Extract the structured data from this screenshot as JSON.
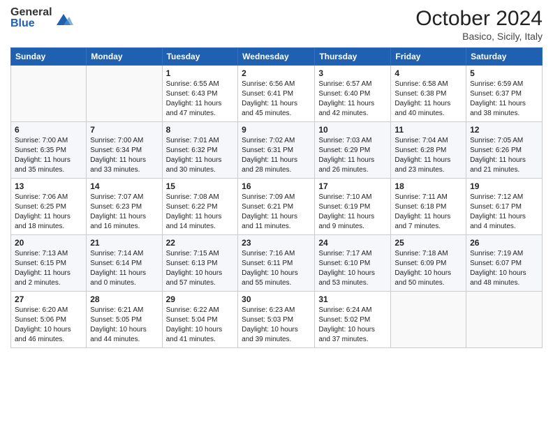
{
  "logo": {
    "general": "General",
    "blue": "Blue"
  },
  "header": {
    "month": "October 2024",
    "location": "Basico, Sicily, Italy"
  },
  "weekdays": [
    "Sunday",
    "Monday",
    "Tuesday",
    "Wednesday",
    "Thursday",
    "Friday",
    "Saturday"
  ],
  "weeks": [
    [
      {
        "day": "",
        "info": ""
      },
      {
        "day": "",
        "info": ""
      },
      {
        "day": "1",
        "info": "Sunrise: 6:55 AM\nSunset: 6:43 PM\nDaylight: 11 hours and 47 minutes."
      },
      {
        "day": "2",
        "info": "Sunrise: 6:56 AM\nSunset: 6:41 PM\nDaylight: 11 hours and 45 minutes."
      },
      {
        "day": "3",
        "info": "Sunrise: 6:57 AM\nSunset: 6:40 PM\nDaylight: 11 hours and 42 minutes."
      },
      {
        "day": "4",
        "info": "Sunrise: 6:58 AM\nSunset: 6:38 PM\nDaylight: 11 hours and 40 minutes."
      },
      {
        "day": "5",
        "info": "Sunrise: 6:59 AM\nSunset: 6:37 PM\nDaylight: 11 hours and 38 minutes."
      }
    ],
    [
      {
        "day": "6",
        "info": "Sunrise: 7:00 AM\nSunset: 6:35 PM\nDaylight: 11 hours and 35 minutes."
      },
      {
        "day": "7",
        "info": "Sunrise: 7:00 AM\nSunset: 6:34 PM\nDaylight: 11 hours and 33 minutes."
      },
      {
        "day": "8",
        "info": "Sunrise: 7:01 AM\nSunset: 6:32 PM\nDaylight: 11 hours and 30 minutes."
      },
      {
        "day": "9",
        "info": "Sunrise: 7:02 AM\nSunset: 6:31 PM\nDaylight: 11 hours and 28 minutes."
      },
      {
        "day": "10",
        "info": "Sunrise: 7:03 AM\nSunset: 6:29 PM\nDaylight: 11 hours and 26 minutes."
      },
      {
        "day": "11",
        "info": "Sunrise: 7:04 AM\nSunset: 6:28 PM\nDaylight: 11 hours and 23 minutes."
      },
      {
        "day": "12",
        "info": "Sunrise: 7:05 AM\nSunset: 6:26 PM\nDaylight: 11 hours and 21 minutes."
      }
    ],
    [
      {
        "day": "13",
        "info": "Sunrise: 7:06 AM\nSunset: 6:25 PM\nDaylight: 11 hours and 18 minutes."
      },
      {
        "day": "14",
        "info": "Sunrise: 7:07 AM\nSunset: 6:23 PM\nDaylight: 11 hours and 16 minutes."
      },
      {
        "day": "15",
        "info": "Sunrise: 7:08 AM\nSunset: 6:22 PM\nDaylight: 11 hours and 14 minutes."
      },
      {
        "day": "16",
        "info": "Sunrise: 7:09 AM\nSunset: 6:21 PM\nDaylight: 11 hours and 11 minutes."
      },
      {
        "day": "17",
        "info": "Sunrise: 7:10 AM\nSunset: 6:19 PM\nDaylight: 11 hours and 9 minutes."
      },
      {
        "day": "18",
        "info": "Sunrise: 7:11 AM\nSunset: 6:18 PM\nDaylight: 11 hours and 7 minutes."
      },
      {
        "day": "19",
        "info": "Sunrise: 7:12 AM\nSunset: 6:17 PM\nDaylight: 11 hours and 4 minutes."
      }
    ],
    [
      {
        "day": "20",
        "info": "Sunrise: 7:13 AM\nSunset: 6:15 PM\nDaylight: 11 hours and 2 minutes."
      },
      {
        "day": "21",
        "info": "Sunrise: 7:14 AM\nSunset: 6:14 PM\nDaylight: 11 hours and 0 minutes."
      },
      {
        "day": "22",
        "info": "Sunrise: 7:15 AM\nSunset: 6:13 PM\nDaylight: 10 hours and 57 minutes."
      },
      {
        "day": "23",
        "info": "Sunrise: 7:16 AM\nSunset: 6:11 PM\nDaylight: 10 hours and 55 minutes."
      },
      {
        "day": "24",
        "info": "Sunrise: 7:17 AM\nSunset: 6:10 PM\nDaylight: 10 hours and 53 minutes."
      },
      {
        "day": "25",
        "info": "Sunrise: 7:18 AM\nSunset: 6:09 PM\nDaylight: 10 hours and 50 minutes."
      },
      {
        "day": "26",
        "info": "Sunrise: 7:19 AM\nSunset: 6:07 PM\nDaylight: 10 hours and 48 minutes."
      }
    ],
    [
      {
        "day": "27",
        "info": "Sunrise: 6:20 AM\nSunset: 5:06 PM\nDaylight: 10 hours and 46 minutes."
      },
      {
        "day": "28",
        "info": "Sunrise: 6:21 AM\nSunset: 5:05 PM\nDaylight: 10 hours and 44 minutes."
      },
      {
        "day": "29",
        "info": "Sunrise: 6:22 AM\nSunset: 5:04 PM\nDaylight: 10 hours and 41 minutes."
      },
      {
        "day": "30",
        "info": "Sunrise: 6:23 AM\nSunset: 5:03 PM\nDaylight: 10 hours and 39 minutes."
      },
      {
        "day": "31",
        "info": "Sunrise: 6:24 AM\nSunset: 5:02 PM\nDaylight: 10 hours and 37 minutes."
      },
      {
        "day": "",
        "info": ""
      },
      {
        "day": "",
        "info": ""
      }
    ]
  ]
}
